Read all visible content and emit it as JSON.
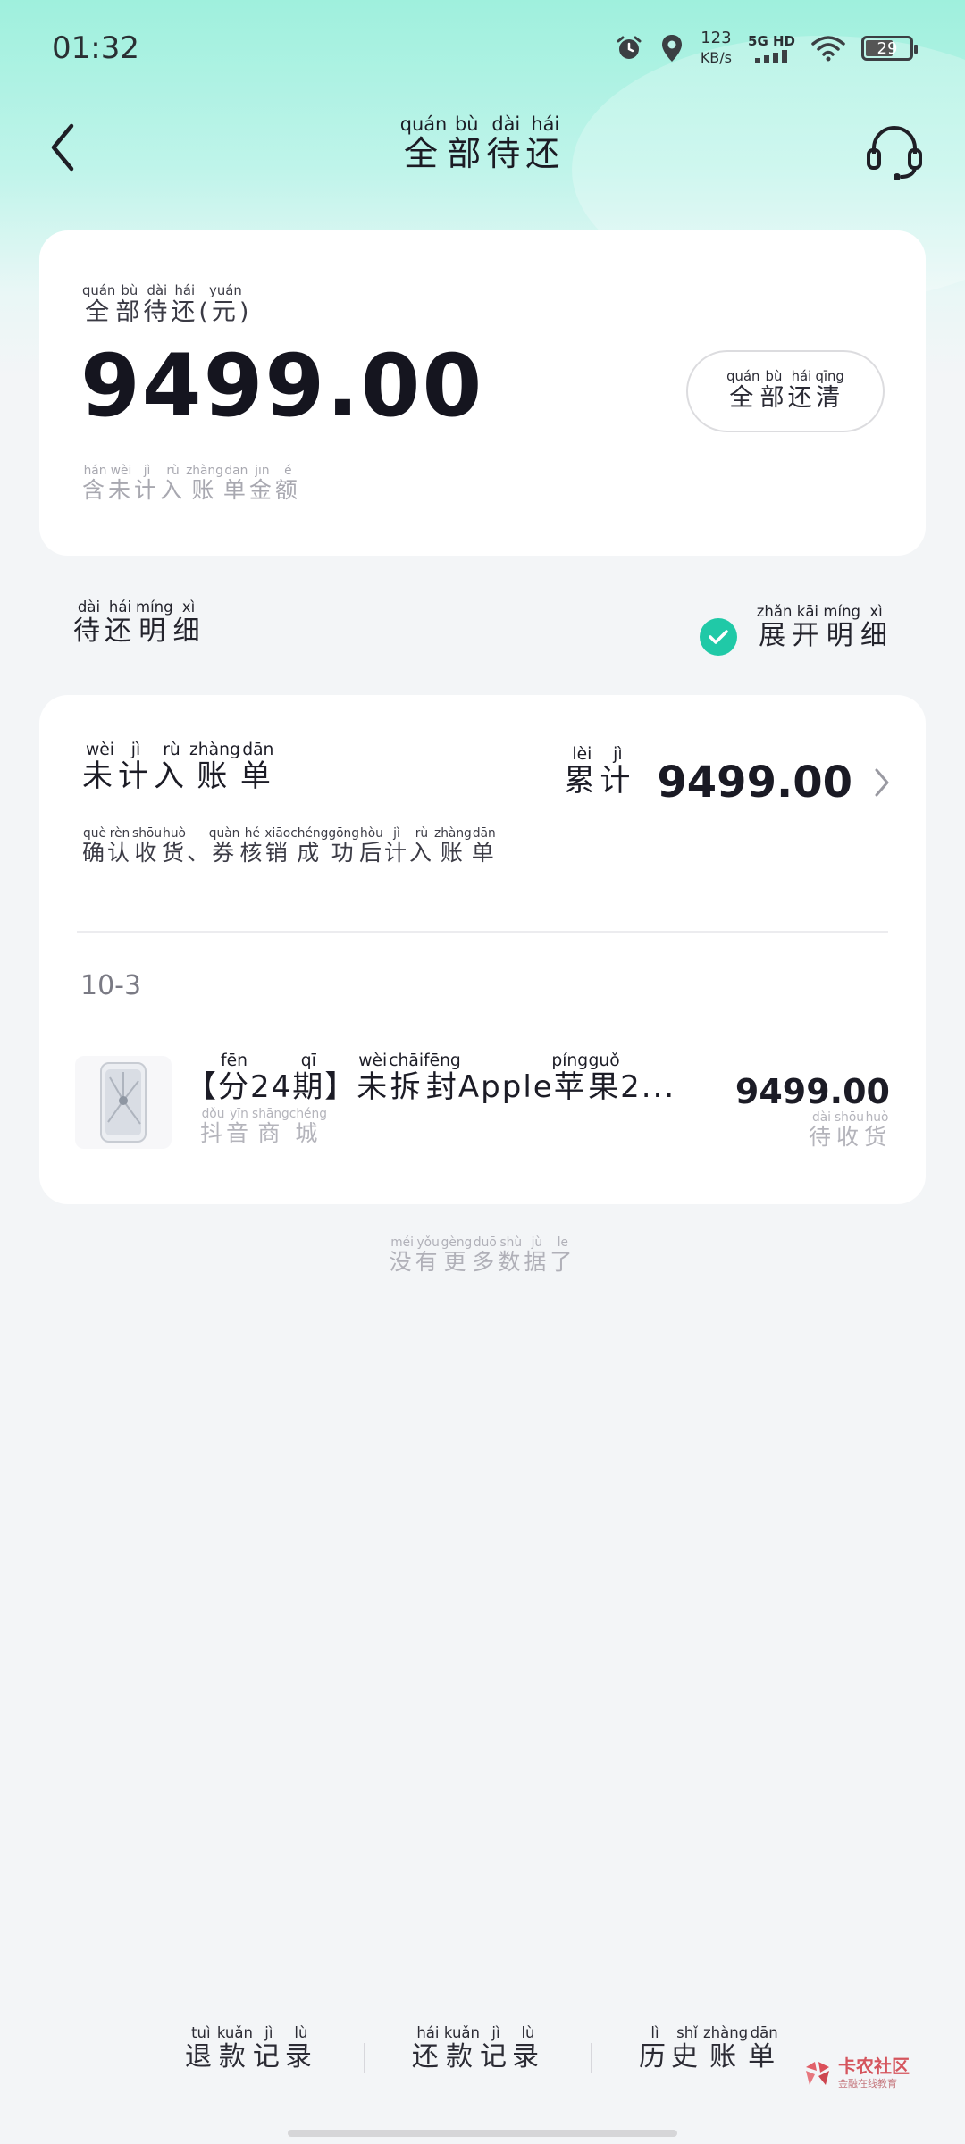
{
  "status_bar": {
    "time": "01:32",
    "net_speed": "123",
    "net_unit": "KB/s",
    "signal_label": "5G HD",
    "battery": "29",
    "icons": [
      "alarm-icon",
      "location-icon",
      "signal-icon",
      "wifi-icon",
      "battery-icon"
    ]
  },
  "header": {
    "title": [
      {
        "han": "全",
        "py": "quán"
      },
      {
        "han": "部",
        "py": "bù"
      },
      {
        "han": "待",
        "py": "dài"
      },
      {
        "han": "还",
        "py": "hái"
      }
    ],
    "back_icon": "chevron-left-icon",
    "service_icon": "headset-icon"
  },
  "summary": {
    "label": [
      {
        "han": "全",
        "py": "quán"
      },
      {
        "han": "部",
        "py": "bù"
      },
      {
        "han": "待",
        "py": "dài"
      },
      {
        "han": "还",
        "py": "hái"
      },
      {
        "han": "(",
        "py": ""
      },
      {
        "han": "元",
        "py": "yuán"
      },
      {
        "han": ")",
        "py": ""
      }
    ],
    "amount": "9499.00",
    "note": [
      {
        "han": "含",
        "py": "hán"
      },
      {
        "han": "未",
        "py": "wèi"
      },
      {
        "han": "计",
        "py": "jì"
      },
      {
        "han": "入",
        "py": "rù"
      },
      {
        "han": "账",
        "py": "zhàng"
      },
      {
        "han": "单",
        "py": "dān"
      },
      {
        "han": "金",
        "py": "jīn"
      },
      {
        "han": "额",
        "py": "é"
      }
    ],
    "payoff_button": [
      {
        "han": "全",
        "py": "quán"
      },
      {
        "han": "部",
        "py": "bù"
      },
      {
        "han": "还",
        "py": "hái"
      },
      {
        "han": "清",
        "py": "qīng"
      }
    ]
  },
  "details": {
    "title": [
      {
        "han": "待",
        "py": "dài"
      },
      {
        "han": "还",
        "py": "hái"
      },
      {
        "han": "明",
        "py": "míng"
      },
      {
        "han": "细",
        "py": "xì"
      }
    ],
    "expand_label": [
      {
        "han": "展",
        "py": "zhǎn"
      },
      {
        "han": "开",
        "py": "kāi"
      },
      {
        "han": "明",
        "py": "míng"
      },
      {
        "han": "细",
        "py": "xì"
      }
    ],
    "expand_checked": true,
    "accent_color": "#20c9a7"
  },
  "bill": {
    "title": [
      {
        "han": "未",
        "py": "wèi"
      },
      {
        "han": "计",
        "py": "jì"
      },
      {
        "han": "入",
        "py": "rù"
      },
      {
        "han": "账",
        "py": "zhàng"
      },
      {
        "han": "单",
        "py": "dān"
      }
    ],
    "cumulative_label": [
      {
        "han": "累",
        "py": "lèi"
      },
      {
        "han": "计",
        "py": "jì"
      }
    ],
    "cumulative_amount": "9499.00",
    "description": [
      {
        "han": "确",
        "py": "què"
      },
      {
        "han": "认",
        "py": "rèn"
      },
      {
        "han": "收",
        "py": "shōu"
      },
      {
        "han": "货",
        "py": "huò"
      },
      {
        "han": "、",
        "py": ""
      },
      {
        "han": "券",
        "py": "quàn"
      },
      {
        "han": "核",
        "py": "hé"
      },
      {
        "han": "销",
        "py": "xiāo"
      },
      {
        "han": "成",
        "py": "chéng"
      },
      {
        "han": "功",
        "py": "gōng"
      },
      {
        "han": "后",
        "py": "hòu"
      },
      {
        "han": "计",
        "py": "jì"
      },
      {
        "han": "入",
        "py": "rù"
      },
      {
        "han": "账",
        "py": "zhàng"
      },
      {
        "han": "单",
        "py": "dān"
      }
    ],
    "date": "10-3",
    "order": {
      "title": [
        {
          "han": "【",
          "py": ""
        },
        {
          "han": "分",
          "py": "fēn"
        },
        {
          "han": "24",
          "py": ""
        },
        {
          "han": "期",
          "py": "qī"
        },
        {
          "han": "】",
          "py": ""
        },
        {
          "han": "未",
          "py": "wèi"
        },
        {
          "han": "拆",
          "py": "chāi"
        },
        {
          "han": "封",
          "py": "fēng"
        },
        {
          "han": "Apple",
          "py": ""
        },
        {
          "han": "苹",
          "py": "píng"
        },
        {
          "han": "果",
          "py": "guǒ"
        },
        {
          "han": "2...",
          "py": ""
        }
      ],
      "merchant": [
        {
          "han": "抖",
          "py": "dǒu"
        },
        {
          "han": "音",
          "py": "yīn"
        },
        {
          "han": "商",
          "py": "shāng"
        },
        {
          "han": "城",
          "py": "chéng"
        }
      ],
      "amount": "9499.00",
      "status": [
        {
          "han": "待",
          "py": "dài"
        },
        {
          "han": "收",
          "py": "shōu"
        },
        {
          "han": "货",
          "py": "huò"
        }
      ]
    }
  },
  "no_more": [
    {
      "han": "没",
      "py": "méi"
    },
    {
      "han": "有",
      "py": "yǒu"
    },
    {
      "han": "更",
      "py": "gèng"
    },
    {
      "han": "多",
      "py": "duō"
    },
    {
      "han": "数",
      "py": "shù"
    },
    {
      "han": "据",
      "py": "jù"
    },
    {
      "han": "了",
      "py": "le"
    }
  ],
  "footer": {
    "refund_records": [
      {
        "han": "退",
        "py": "tuì"
      },
      {
        "han": "款",
        "py": "kuǎn"
      },
      {
        "han": "记",
        "py": "jì"
      },
      {
        "han": "录",
        "py": "lù"
      }
    ],
    "repay_records": [
      {
        "han": "还",
        "py": "hái"
      },
      {
        "han": "款",
        "py": "kuǎn"
      },
      {
        "han": "记",
        "py": "jì"
      },
      {
        "han": "录",
        "py": "lù"
      }
    ],
    "history_bills": [
      {
        "han": "历",
        "py": "lì"
      },
      {
        "han": "史",
        "py": "shǐ"
      },
      {
        "han": "账",
        "py": "zhàng"
      },
      {
        "han": "单",
        "py": "dān"
      }
    ]
  },
  "watermark": {
    "name": "卡农社区",
    "sub": "金融在线教育"
  }
}
